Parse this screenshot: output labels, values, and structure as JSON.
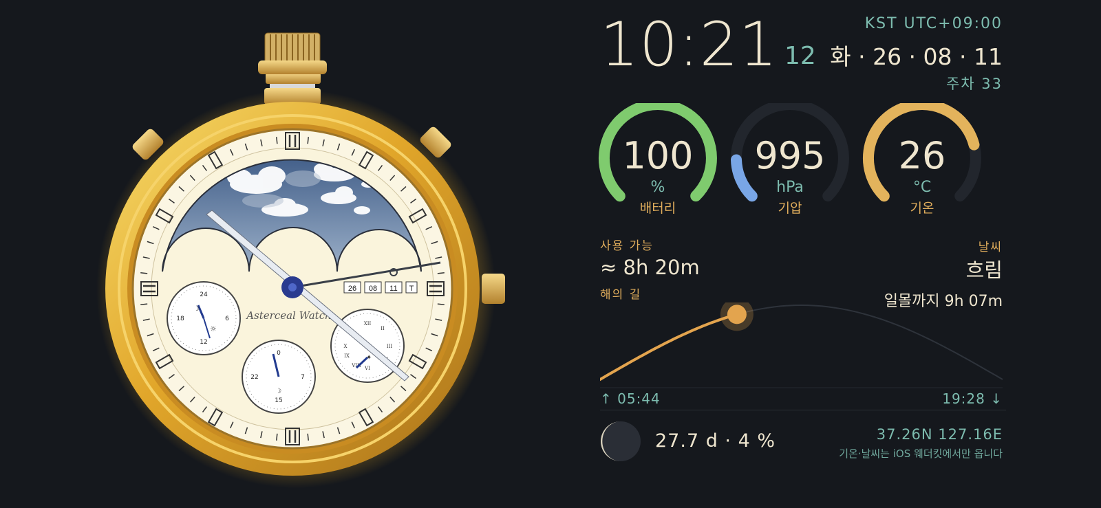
{
  "clock": {
    "time": "10:21",
    "seconds": "12",
    "timezone": "KST UTC+09:00",
    "date": "화 · 26 · 08 · 11",
    "week": "주차 33"
  },
  "watch": {
    "brand": "Asterceal Watch",
    "date_windows": [
      "26",
      "08",
      "11",
      "T"
    ],
    "subdial_left_numbers": [
      "24",
      "6",
      "12",
      "18"
    ],
    "subdial_bottom_numbers": [
      "0",
      "7",
      "15",
      "22"
    ],
    "roman_numerals": [
      "XII",
      "II",
      "III",
      "IV",
      "VI",
      "VIII",
      "IX",
      "X"
    ]
  },
  "gauges": [
    {
      "value": "100",
      "unit": "%",
      "label": "배터리",
      "fraction": 1.0,
      "color": "#7fcb6e"
    },
    {
      "value": "995",
      "unit": "hPa",
      "label": "기압",
      "fraction": 0.16,
      "color": "#79a6e6"
    },
    {
      "value": "26",
      "unit": "°C",
      "label": "기온",
      "fraction": 0.78,
      "color": "#e3b35c"
    }
  ],
  "battery_time": {
    "label": "사용 가능",
    "value": "≈ 8h 20m"
  },
  "weather": {
    "label": "날씨",
    "value": "흐림"
  },
  "sun": {
    "label": "해의 길",
    "remaining": "일몰까지 9h 07m",
    "sunrise": "↑ 05:44",
    "sunset": "19:28 ↓",
    "day_progress": 0.34,
    "color": "#e3a44e"
  },
  "moon": {
    "text": "27.7 d · 4 %",
    "illumination": 0.04
  },
  "location": {
    "coords": "37.26N  127.16E"
  },
  "note": "기온·날씨는 iOS 웨더킷에서만 옵니다"
}
